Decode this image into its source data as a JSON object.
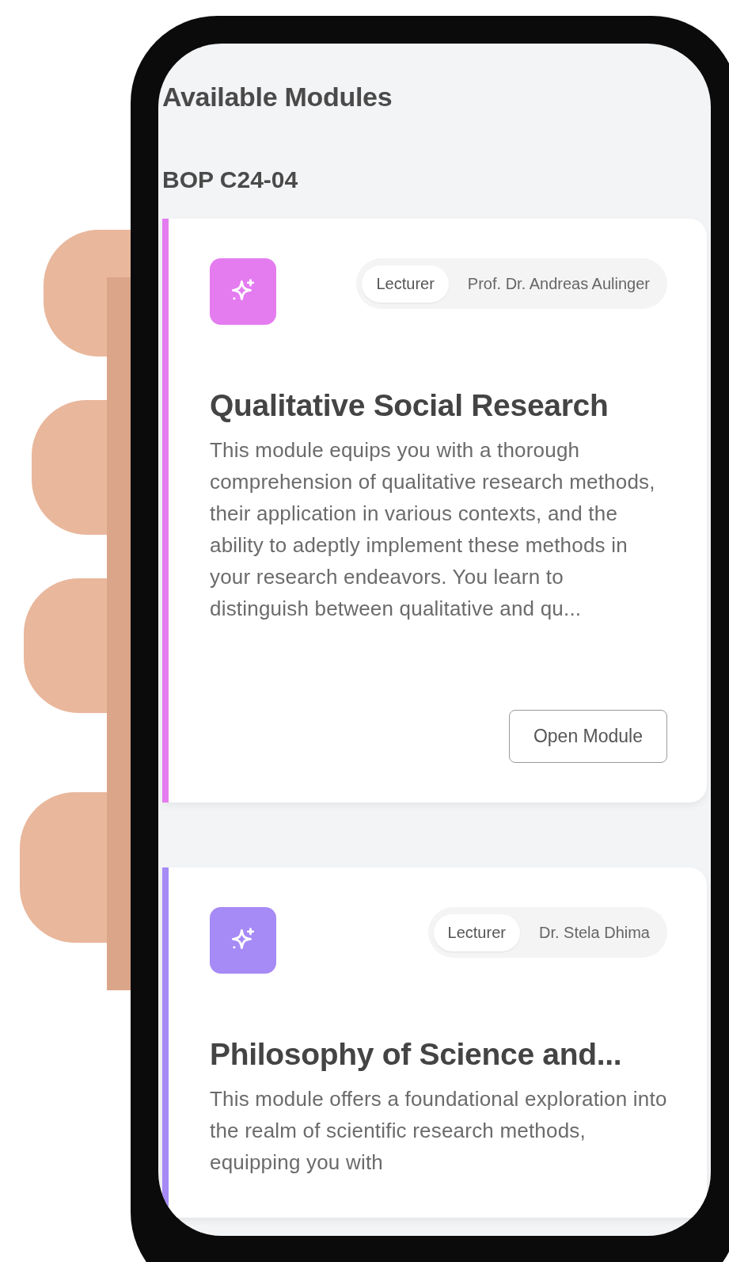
{
  "header": {
    "title": "Available Modules",
    "group": "BOP C24-04"
  },
  "modules": [
    {
      "color": "#e47cf0",
      "lecturer_label": "Lecturer",
      "lecturer": "Prof. Dr. Andreas Aulinger",
      "title": "Qualitative Social Research",
      "description": "This module equips you with a thorough comprehension of qualitative research methods, their application in various contexts, and the ability to adeptly implement these methods in your research endeavors. You learn to distinguish between qualitative and qu...",
      "button": "Open Module"
    },
    {
      "color": "#a68af5",
      "lecturer_label": "Lecturer",
      "lecturer": "Dr. Stela Dhima",
      "title": "Philosophy of Science and...",
      "description": "This module offers a foundational exploration into the realm of scientific research methods, equipping you with"
    }
  ]
}
